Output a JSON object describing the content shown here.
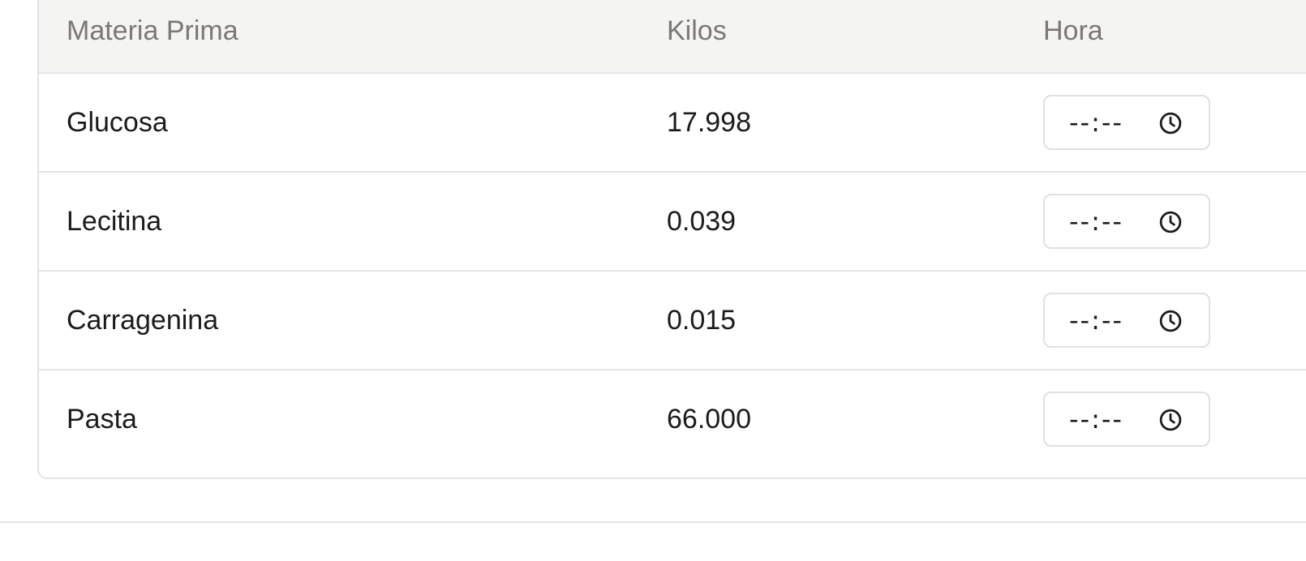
{
  "table": {
    "headers": {
      "name": "Materia Prima",
      "kilos": "Kilos",
      "hora": "Hora"
    },
    "rows": [
      {
        "name": "Glucosa",
        "kilos": "17.998",
        "hora_value": "--:--",
        "hora_icon": "clock-icon"
      },
      {
        "name": "Lecitina",
        "kilos": "0.039",
        "hora_value": "--:--",
        "hora_icon": "clock-icon"
      },
      {
        "name": "Carragenina",
        "kilos": "0.015",
        "hora_value": "--:--",
        "hora_icon": "clock-icon"
      },
      {
        "name": "Pasta",
        "kilos": "66.000",
        "hora_value": "--:--",
        "hora_icon": "clock-icon"
      }
    ]
  },
  "colors": {
    "header_bg": "#f4f4f2",
    "header_text": "#7c7772",
    "border": "#e4e3e1",
    "text": "#1b1b1b"
  }
}
